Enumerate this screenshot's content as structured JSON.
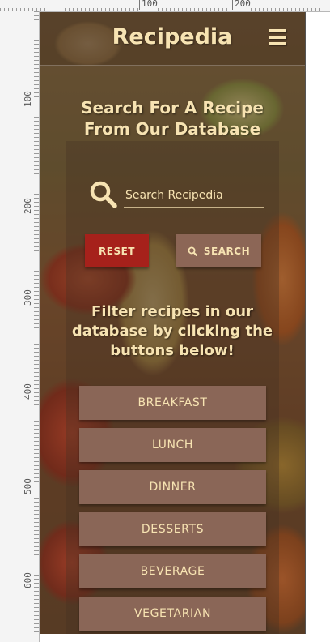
{
  "ruler": {
    "top_labels": [
      "100",
      "200"
    ],
    "left_labels": [
      "100",
      "200",
      "300",
      "400",
      "500",
      "600"
    ]
  },
  "app": {
    "title": "Recipedia",
    "menu_icon": "hamburger-menu-icon"
  },
  "search": {
    "headline": "Search For A Recipe From Our Database",
    "placeholder": "Search Recipedia",
    "icon": "magnifier-icon",
    "reset_label": "RESET",
    "search_label": "SEARCH"
  },
  "filter": {
    "prompt": "Filter recipes in our database by clicking the buttons below!",
    "categories": [
      "BREAKFAST",
      "LUNCH",
      "DINNER",
      "DESSERTS",
      "BEVERAGE",
      "VEGETARIAN"
    ]
  },
  "colors": {
    "accent_text": "#f7e3b2",
    "reset": "#a6211b",
    "button": "#8a6657"
  }
}
